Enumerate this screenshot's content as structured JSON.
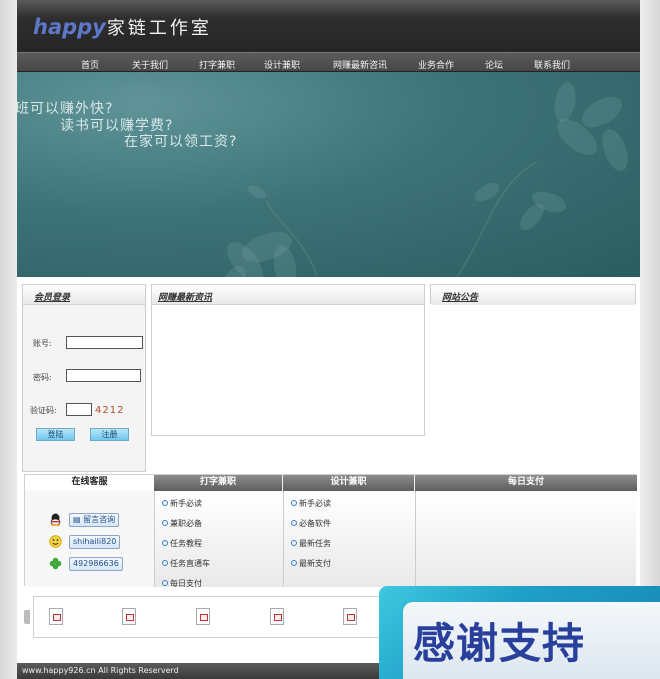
{
  "logo": {
    "en": "happy",
    "cn": "家链工作室"
  },
  "nav": [
    "首页",
    "关于我们",
    "打字兼职",
    "设计兼职",
    "网赚最新咨讯",
    "业务合作",
    "论坛",
    "联系我们"
  ],
  "banner": {
    "lines": [
      "班可以赚外快?",
      "读书可以赚学费?",
      "在家可以领工资?"
    ]
  },
  "login": {
    "title": "会员登录",
    "account_label": "账号:",
    "password_label": "密码:",
    "captcha_label": "验证码:",
    "captcha_code": "4212",
    "login_button": "登陆",
    "register_button": "注册"
  },
  "news": {
    "title": "网赚最新资讯"
  },
  "notice": {
    "title": "网站公告"
  },
  "tabs": {
    "service": {
      "title": "在线客服",
      "items": [
        "留言咨询",
        "shihaili820",
        "492986636"
      ]
    },
    "typing": {
      "title": "打字兼职",
      "items": [
        "新手必读",
        "兼职必备",
        "任务教程",
        "任务直通车",
        "每日支付"
      ]
    },
    "design": {
      "title": "设计兼职",
      "items": [
        "新手必读",
        "必备软件",
        "最新任务",
        "最新支付"
      ]
    },
    "daily": {
      "title": "每日支付"
    }
  },
  "footer": {
    "text": "www.happy926.cn  All Rights Reserverd"
  },
  "overlay": {
    "text": "感谢支持"
  },
  "colors": {
    "accent_blue": "#5d77c9",
    "banner_teal": "#3d7377",
    "captcha_red": "#b14a2a"
  }
}
